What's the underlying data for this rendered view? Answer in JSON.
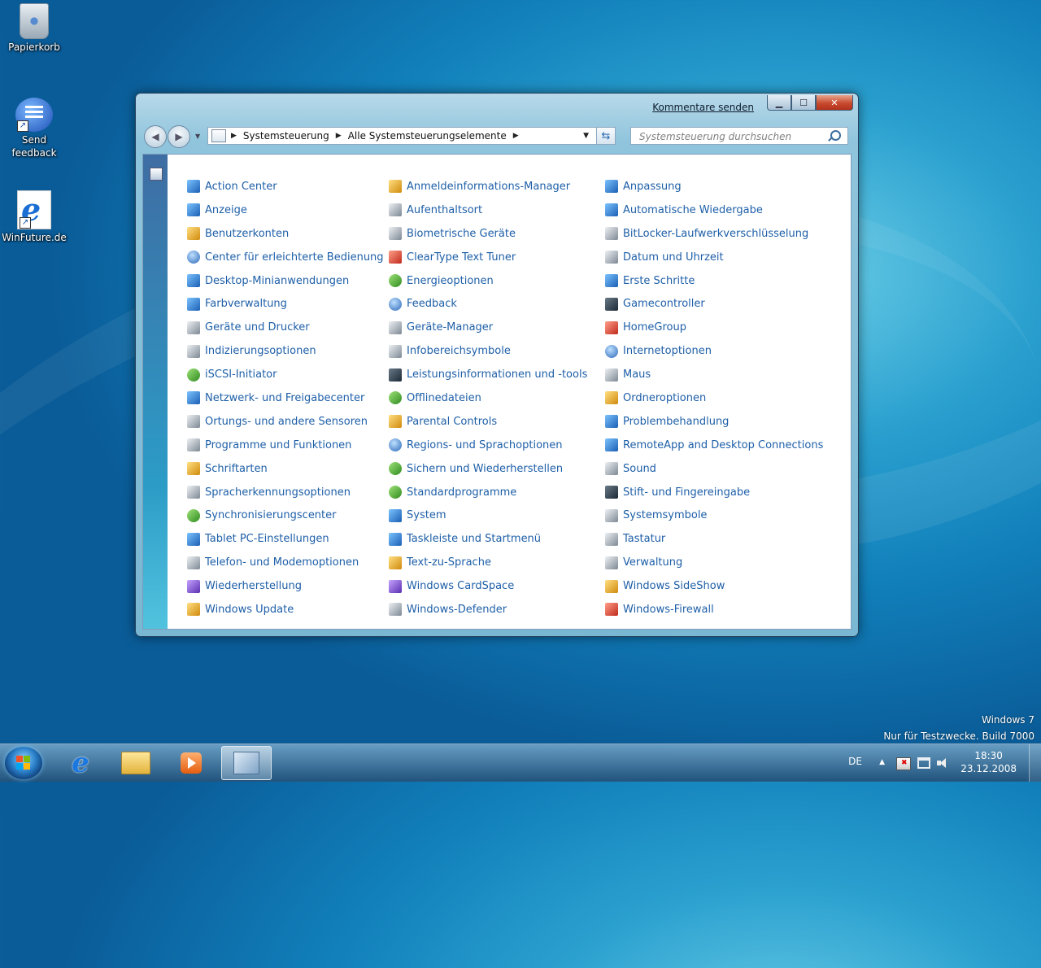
{
  "desktop": {
    "icons": [
      {
        "label": "Papierkorb",
        "icon": "recycle-bin-icon"
      },
      {
        "label": "Send\nfeedback",
        "icon": "feedback-icon"
      },
      {
        "label": "WinFuture.de",
        "icon": "internet-explorer-icon"
      }
    ],
    "branding": {
      "line1": "Windows 7",
      "line2": "Nur für Testzwecke. Build 7000"
    }
  },
  "window": {
    "kommentare": "Kommentare senden",
    "breadcrumb": [
      "Systemsteuerung",
      "Alle Systemsteuerungselemente"
    ],
    "search_placeholder": "Systemsteuerung durchsuchen",
    "columns": [
      [
        {
          "label": "Action Center",
          "color": "c-blue"
        },
        {
          "label": "Anzeige",
          "color": "c-blue"
        },
        {
          "label": "Benutzerkonten",
          "color": "c-yellow"
        },
        {
          "label": "Center für erleichterte Bedienung",
          "color": "c-round"
        },
        {
          "label": "Desktop-Minianwendungen",
          "color": "c-blue"
        },
        {
          "label": "Farbverwaltung",
          "color": "c-blue"
        },
        {
          "label": "Geräte und Drucker",
          "color": "c-gray"
        },
        {
          "label": "Indizierungsoptionen",
          "color": "c-gray"
        },
        {
          "label": "iSCSI-Initiator",
          "color": "c-green"
        },
        {
          "label": "Netzwerk- und Freigabecenter",
          "color": "c-blue"
        },
        {
          "label": "Ortungs- und andere Sensoren",
          "color": "c-gray"
        },
        {
          "label": "Programme und Funktionen",
          "color": "c-gray"
        },
        {
          "label": "Schriftarten",
          "color": "c-yellow"
        },
        {
          "label": "Spracherkennungsoptionen",
          "color": "c-gray"
        },
        {
          "label": "Synchronisierungscenter",
          "color": "c-green"
        },
        {
          "label": "Tablet PC-Einstellungen",
          "color": "c-blue"
        },
        {
          "label": "Telefon- und Modemoptionen",
          "color": "c-gray"
        },
        {
          "label": "Wiederherstellung",
          "color": "c-purple"
        },
        {
          "label": "Windows Update",
          "color": "c-yellow"
        }
      ],
      [
        {
          "label": "Anmeldeinformations-Manager",
          "color": "c-yellow"
        },
        {
          "label": "Aufenthaltsort",
          "color": "c-gray"
        },
        {
          "label": "Biometrische Geräte",
          "color": "c-gray"
        },
        {
          "label": "ClearType Text Tuner",
          "color": "c-red"
        },
        {
          "label": "Energieoptionen",
          "color": "c-green"
        },
        {
          "label": "Feedback",
          "color": "c-round"
        },
        {
          "label": "Geräte-Manager",
          "color": "c-gray"
        },
        {
          "label": "Infobereichsymbole",
          "color": "c-gray"
        },
        {
          "label": "Leistungsinformationen und -tools",
          "color": "c-dark"
        },
        {
          "label": "Offlinedateien",
          "color": "c-green"
        },
        {
          "label": "Parental Controls",
          "color": "c-yellow"
        },
        {
          "label": "Regions- und Sprachoptionen",
          "color": "c-round"
        },
        {
          "label": "Sichern und Wiederherstellen",
          "color": "c-green"
        },
        {
          "label": "Standardprogramme",
          "color": "c-green"
        },
        {
          "label": "System",
          "color": "c-blue"
        },
        {
          "label": "Taskleiste und Startmenü",
          "color": "c-blue"
        },
        {
          "label": "Text-zu-Sprache",
          "color": "c-yellow"
        },
        {
          "label": "Windows CardSpace",
          "color": "c-purple"
        },
        {
          "label": "Windows-Defender",
          "color": "c-gray"
        }
      ],
      [
        {
          "label": "Anpassung",
          "color": "c-blue"
        },
        {
          "label": "Automatische Wiedergabe",
          "color": "c-blue"
        },
        {
          "label": "BitLocker-Laufwerkverschlüsselung",
          "color": "c-gray"
        },
        {
          "label": "Datum und Uhrzeit",
          "color": "c-gray"
        },
        {
          "label": "Erste Schritte",
          "color": "c-blue"
        },
        {
          "label": "Gamecontroller",
          "color": "c-dark"
        },
        {
          "label": "HomeGroup",
          "color": "c-red"
        },
        {
          "label": "Internetoptionen",
          "color": "c-round"
        },
        {
          "label": "Maus",
          "color": "c-gray"
        },
        {
          "label": "Ordneroptionen",
          "color": "c-yellow"
        },
        {
          "label": "Problembehandlung",
          "color": "c-blue"
        },
        {
          "label": "RemoteApp and Desktop Connections",
          "color": "c-blue"
        },
        {
          "label": "Sound",
          "color": "c-gray"
        },
        {
          "label": "Stift- und Fingereingabe",
          "color": "c-dark"
        },
        {
          "label": "Systemsymbole",
          "color": "c-gray"
        },
        {
          "label": "Tastatur",
          "color": "c-gray"
        },
        {
          "label": "Verwaltung",
          "color": "c-gray"
        },
        {
          "label": "Windows SideShow",
          "color": "c-yellow"
        },
        {
          "label": "Windows-Firewall",
          "color": "c-red"
        }
      ]
    ]
  },
  "taskbar": {
    "items": [
      "start-orb",
      "internet-explorer",
      "windows-explorer",
      "media-player",
      "control-panel"
    ],
    "language": "DE",
    "time": "18:30",
    "date": "23.12.2008"
  }
}
